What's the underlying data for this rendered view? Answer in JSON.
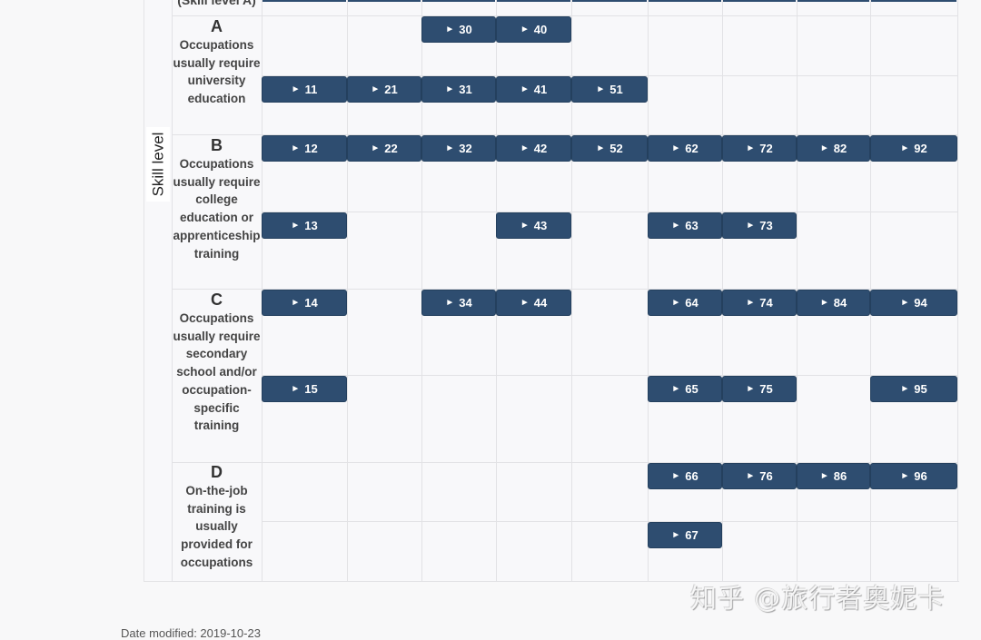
{
  "axis_label": "Skill level",
  "cut_header_label": "(Skill level A)",
  "skill_levels": [
    {
      "letter": "A",
      "description": "Occupations usually require university education"
    },
    {
      "letter": "B",
      "description": "Occupations usually require college education or apprenticeship training"
    },
    {
      "letter": "C",
      "description": "Occupations usually require secondary school and/or occupation-specific training"
    },
    {
      "letter": "D",
      "description": "On-the-job training is usually provided for occupations"
    }
  ],
  "button_icon": "play-triangle-icon",
  "button_glyph": "►",
  "occupation_buttons": [
    {
      "code": "30",
      "row": 0,
      "col": 2
    },
    {
      "code": "40",
      "row": 0,
      "col": 3
    },
    {
      "code": "11",
      "row": 1,
      "col": 0
    },
    {
      "code": "21",
      "row": 1,
      "col": 1
    },
    {
      "code": "31",
      "row": 1,
      "col": 2
    },
    {
      "code": "41",
      "row": 1,
      "col": 3
    },
    {
      "code": "51",
      "row": 1,
      "col": 4
    },
    {
      "code": "12",
      "row": 2,
      "col": 0
    },
    {
      "code": "22",
      "row": 2,
      "col": 1
    },
    {
      "code": "32",
      "row": 2,
      "col": 2
    },
    {
      "code": "42",
      "row": 2,
      "col": 3
    },
    {
      "code": "52",
      "row": 2,
      "col": 4
    },
    {
      "code": "62",
      "row": 2,
      "col": 5
    },
    {
      "code": "72",
      "row": 2,
      "col": 6
    },
    {
      "code": "82",
      "row": 2,
      "col": 7
    },
    {
      "code": "92",
      "row": 2,
      "col": 8
    },
    {
      "code": "13",
      "row": 3,
      "col": 0
    },
    {
      "code": "43",
      "row": 3,
      "col": 3
    },
    {
      "code": "63",
      "row": 3,
      "col": 5
    },
    {
      "code": "73",
      "row": 3,
      "col": 6
    },
    {
      "code": "14",
      "row": 4,
      "col": 0
    },
    {
      "code": "34",
      "row": 4,
      "col": 2
    },
    {
      "code": "44",
      "row": 4,
      "col": 3
    },
    {
      "code": "64",
      "row": 4,
      "col": 5
    },
    {
      "code": "74",
      "row": 4,
      "col": 6
    },
    {
      "code": "84",
      "row": 4,
      "col": 7
    },
    {
      "code": "94",
      "row": 4,
      "col": 8
    },
    {
      "code": "15",
      "row": 5,
      "col": 0
    },
    {
      "code": "65",
      "row": 5,
      "col": 5
    },
    {
      "code": "75",
      "row": 5,
      "col": 6
    },
    {
      "code": "95",
      "row": 5,
      "col": 8
    },
    {
      "code": "66",
      "row": 6,
      "col": 5
    },
    {
      "code": "76",
      "row": 6,
      "col": 6
    },
    {
      "code": "86",
      "row": 6,
      "col": 7
    },
    {
      "code": "96",
      "row": 6,
      "col": 8
    },
    {
      "code": "67",
      "row": 7,
      "col": 5
    }
  ],
  "footer": {
    "date_modified": "Date modified: 2019-10-23"
  },
  "watermark": "知乎 @旅行者奥妮卡",
  "colors": {
    "button_bg": "#2e4d70",
    "button_text": "#ffffff",
    "grid_line": "#e2e2e5"
  }
}
